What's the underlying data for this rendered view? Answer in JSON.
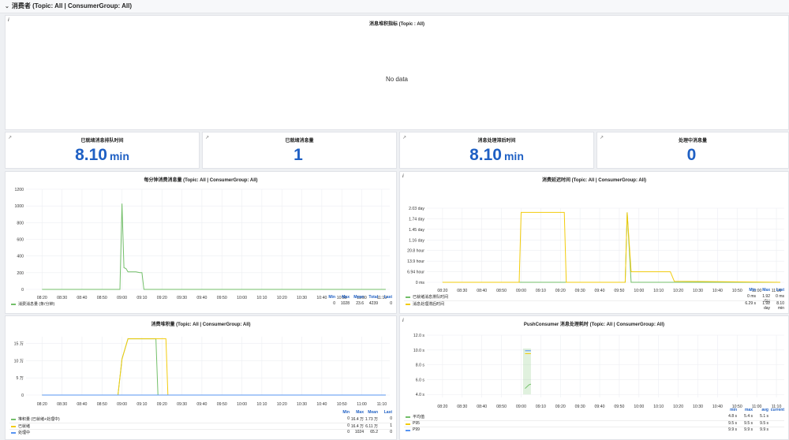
{
  "row": {
    "title": "消费者 (Topic: All | ConsumerGroup: All)"
  },
  "panel_top": {
    "title": "消息堆积指标 (Topic : All)",
    "no_data": "No data"
  },
  "stats": [
    {
      "title": "已就绪消息排队时间",
      "value": "8.10",
      "unit": "min"
    },
    {
      "title": "已就绪消息量",
      "value": "1",
      "unit": ""
    },
    {
      "title": "消息处理滞后时间",
      "value": "8.10",
      "unit": "min"
    },
    {
      "title": "处理中消息量",
      "value": "0",
      "unit": ""
    }
  ],
  "colors": {
    "green": "#73bf69",
    "yellow": "#f2cc0c",
    "orange": "#ff9830",
    "blue": "#5794f2",
    "statBlue": "#1f60c4"
  },
  "time_ticks": [
    "08:20",
    "08:30",
    "08:40",
    "08:50",
    "09:00",
    "09:10",
    "09:20",
    "09:30",
    "09:40",
    "09:50",
    "10:00",
    "10:10",
    "10:20",
    "10:30",
    "10:40",
    "10:50",
    "11:00",
    "11:10"
  ],
  "chart_data": [
    {
      "title": "每分钟消费消息量 (Topic: All | ConsumerGroup: All)",
      "type": "line",
      "y_ticks": [
        "0",
        "200",
        "400",
        "600",
        "800",
        "1000",
        "1200"
      ],
      "ylim": [
        0,
        1200
      ],
      "legend_headers": [
        "Min",
        "Max",
        "Mean",
        "Total",
        "Last"
      ],
      "series": [
        {
          "name": "消费消息量 (条/分钟)",
          "color": "#73bf69",
          "stats": [
            "0",
            "1028",
            "23.6",
            "4239",
            "0"
          ],
          "points": [
            [
              "08:20",
              0
            ],
            [
              "08:59",
              0
            ],
            [
              "09:00",
              1028
            ],
            [
              "09:01",
              260
            ],
            [
              "09:02",
              250
            ],
            [
              "09:03",
              210
            ],
            [
              "09:07",
              210
            ],
            [
              "09:08",
              205
            ],
            [
              "09:09",
              200
            ],
            [
              "09:10",
              200
            ],
            [
              "09:11",
              0
            ],
            [
              "11:12",
              0
            ]
          ]
        }
      ]
    },
    {
      "title": "消费延迟时间 (Topic: All | ConsumerGroup: All)",
      "type": "line",
      "y_ticks": [
        "0 ms",
        "6.94 hour",
        "13.9 hour",
        "20.8 hour",
        "1.16 day",
        "1.45 day",
        "1.74 day",
        "2.03 day"
      ],
      "ylim": [
        0,
        7
      ],
      "legend_headers": [
        "Min",
        "Max",
        "Last"
      ],
      "series": [
        {
          "name": "已就绪消息排队时间",
          "color": "#73bf69",
          "stats": [
            "0 ms",
            "1.92 day",
            "0 ms"
          ],
          "points": [
            [
              "08:20",
              0
            ],
            [
              "09:53",
              0
            ],
            [
              "09:54",
              6.6
            ],
            [
              "09:56",
              0
            ],
            [
              "11:12",
              0
            ]
          ]
        },
        {
          "name": "消息处理滞后时间",
          "color": "#f2cc0c",
          "stats": [
            "6.29 s",
            "1.92 day",
            "8.10 min"
          ],
          "points": [
            [
              "08:20",
              0
            ],
            [
              "08:59",
              0
            ],
            [
              "09:00",
              6.6
            ],
            [
              "09:22",
              6.6
            ],
            [
              "09:23",
              0
            ],
            [
              "09:53",
              0
            ],
            [
              "09:54",
              6.6
            ],
            [
              "09:56",
              1.0
            ],
            [
              "09:57",
              1.0
            ],
            [
              "10:16",
              1.0
            ],
            [
              "10:18",
              0.1
            ],
            [
              "11:12",
              0
            ]
          ]
        }
      ]
    },
    {
      "title": "消费堆积量 (Topic: All | ConsumerGroup: All)",
      "type": "line",
      "y_ticks": [
        "0",
        "5 万",
        "10 万",
        "15 万"
      ],
      "ylim": [
        0,
        17
      ],
      "legend_headers": [
        "Min",
        "Max",
        "Mean",
        "Last"
      ],
      "series": [
        {
          "name": "堆积量 (已就绪+处理中)",
          "color": "#73bf69",
          "stats": [
            "0",
            "16.4 万",
            "1.73 万",
            "0"
          ],
          "points": [
            [
              "08:20",
              0
            ],
            [
              "08:58",
              0
            ],
            [
              "09:00",
              10.5
            ],
            [
              "09:03",
              16.4
            ],
            [
              "09:17",
              16.4
            ],
            [
              "09:18",
              0
            ],
            [
              "11:12",
              0
            ]
          ]
        },
        {
          "name": "已就绪",
          "color": "#f2cc0c",
          "stats": [
            "0",
            "16.4 万",
            "6.11 万",
            "1"
          ],
          "points": [
            [
              "08:20",
              0
            ],
            [
              "08:58",
              0
            ],
            [
              "09:00",
              10.5
            ],
            [
              "09:03",
              16.4
            ],
            [
              "09:22",
              16.4
            ],
            [
              "09:23",
              0
            ],
            [
              "11:12",
              0
            ]
          ]
        },
        {
          "name": "处理中",
          "color": "#5794f2",
          "stats": [
            "0",
            "1024",
            "65.2",
            "0"
          ],
          "points": [
            [
              "08:20",
              0
            ],
            [
              "11:12",
              0
            ]
          ]
        }
      ]
    },
    {
      "title": "PushConsumer 消息处理耗时 (Topic: All | ConsumerGroup: All)",
      "type": "line",
      "y_ticks": [
        "4.0 s",
        "6.0 s",
        "8.0 s",
        "10.0 s",
        "12.0 s"
      ],
      "ylim": [
        3.6,
        12
      ],
      "legend_headers": [
        "min",
        "max",
        "avg",
        "current"
      ],
      "series": [
        {
          "name": "平均值",
          "color": "#73bf69",
          "stats": [
            "4.8 s",
            "5.4 s",
            "5.1 s",
            ""
          ],
          "points": [
            [
              "09:02",
              4.8
            ],
            [
              "09:04",
              5.3
            ],
            [
              "09:05",
              5.4
            ]
          ]
        },
        {
          "name": "P95",
          "color": "#f2cc0c",
          "stats": [
            "9.5 s",
            "9.5 s",
            "9.5 s",
            ""
          ],
          "points": [
            [
              "09:02",
              9.5
            ],
            [
              "09:05",
              9.5
            ]
          ]
        },
        {
          "name": "P99",
          "color": "#5794f2",
          "stats": [
            "9.9 s",
            "9.9 s",
            "9.9 s",
            ""
          ],
          "points": [
            [
              "09:02",
              9.9
            ],
            [
              "09:05",
              9.9
            ]
          ]
        }
      ]
    }
  ]
}
